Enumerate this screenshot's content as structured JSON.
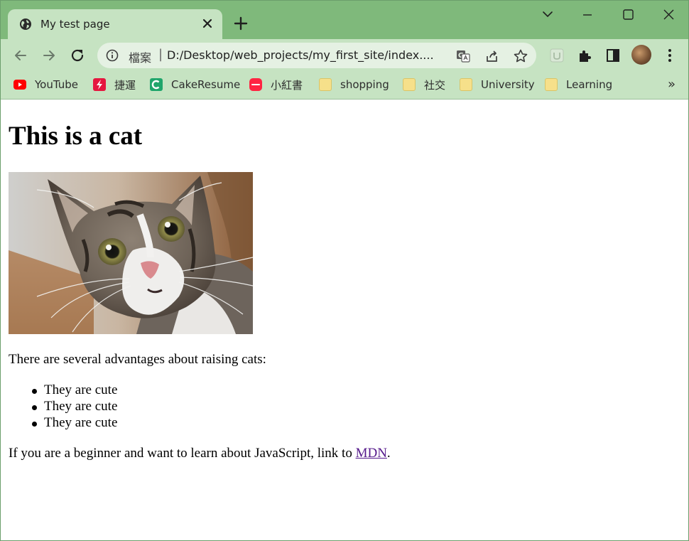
{
  "browser": {
    "tab": {
      "title": "My test page",
      "icon": "globe-icon"
    },
    "address_bar": {
      "prefix": "檔案",
      "url": "D:/Desktop/web_projects/my_first_site/index...."
    },
    "bookmarks": [
      {
        "label": "YouTube",
        "icon": "youtube-icon"
      },
      {
        "label": "捷運",
        "icon": "metro-icon"
      },
      {
        "label": "CakeResume",
        "icon": "cakeresume-icon"
      },
      {
        "label": "小紅書",
        "icon": "xiaohongshu-icon"
      },
      {
        "label": "shopping",
        "icon": "folder-icon"
      },
      {
        "label": "社交",
        "icon": "folder-icon"
      },
      {
        "label": "University",
        "icon": "folder-icon"
      },
      {
        "label": "Learning",
        "icon": "folder-icon"
      }
    ],
    "more_bookmarks": "»",
    "colors": {
      "frame": "#7fb97b",
      "toolbar": "#c6e3c2",
      "link_visited": "#551a8b"
    }
  },
  "page": {
    "heading": "This is a cat",
    "image_subject": "cat photo",
    "intro": "There are several advantages about raising cats:",
    "list_items": [
      "They are cute",
      "They are cute",
      "They are cute"
    ],
    "outro_before": "If you are a beginner and want to learn about JavaScript, link to ",
    "link_text": "MDN",
    "outro_after": "."
  }
}
